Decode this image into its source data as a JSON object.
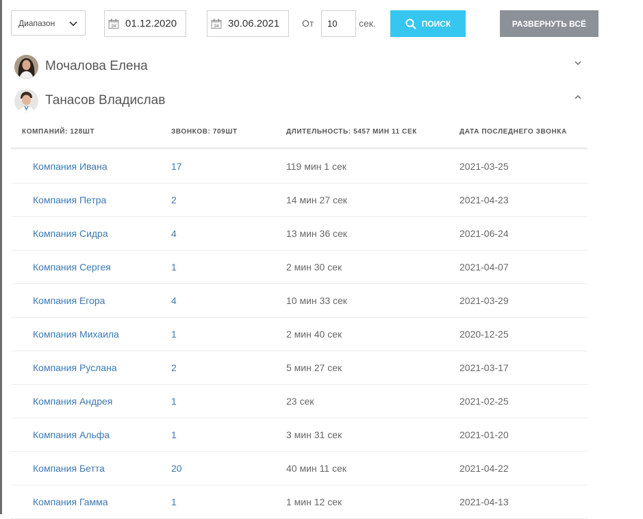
{
  "filters": {
    "range_label": "Диапазон",
    "date_from": "01.12.2020",
    "date_to": "30.06.2021",
    "from_label": "От",
    "seconds_value": "10",
    "seconds_unit": "сек.",
    "search_label": "ПОИСК",
    "expand_all_label": "РАЗВЕРНУТЬ ВСЁ"
  },
  "people": [
    {
      "name": "Мочалова Елена",
      "expanded": false
    },
    {
      "name": "Танасов Владислав",
      "expanded": true
    }
  ],
  "table": {
    "headers": {
      "companies": "КОМПАНИЙ: 128ШТ",
      "calls": "ЗВОНКОВ: 709ШТ",
      "duration": "ДЛИТЕЛЬНОСТЬ: 5457 МИН 11 СЕК",
      "last_call": "ДАТА ПОСЛЕДНЕГО ЗВОНКА"
    },
    "rows": [
      {
        "company": "Компания Ивана",
        "calls": "17",
        "duration": "119 мин 1 сек",
        "date": "2021-03-25"
      },
      {
        "company": "Компания Петра",
        "calls": "2",
        "duration": "14 мин 27 сек",
        "date": "2021-04-23"
      },
      {
        "company": "Компания Сидра",
        "calls": "4",
        "duration": "13 мин 36 сек",
        "date": "2021-06-24"
      },
      {
        "company": "Компания Сергея",
        "calls": "1",
        "duration": "2 мин 30 сек",
        "date": "2021-04-07"
      },
      {
        "company": "Компания Егора",
        "calls": "4",
        "duration": "10 мин 33 сек",
        "date": "2021-03-29"
      },
      {
        "company": "Компания Михаила",
        "calls": "1",
        "duration": "2 мин 40 сек",
        "date": "2020-12-25"
      },
      {
        "company": "Компания Руслана",
        "calls": "2",
        "duration": "5 мин 27 сек",
        "date": "2021-03-17"
      },
      {
        "company": "Компания Андрея",
        "calls": "1",
        "duration": "23 сек",
        "date": "2021-02-25"
      },
      {
        "company": "Компания Альфа",
        "calls": "1",
        "duration": "3 мин 31 сек",
        "date": "2021-01-20"
      },
      {
        "company": "Компания Бетта",
        "calls": "20",
        "duration": "40 мин 11 сек",
        "date": "2021-04-22"
      },
      {
        "company": "Компания Гамма",
        "calls": "1",
        "duration": "1 мин 12 сек",
        "date": "2021-04-13"
      }
    ]
  },
  "colors": {
    "search_button": "#36c6f0",
    "expand_button": "#8c9198",
    "link": "#3b78b2"
  }
}
